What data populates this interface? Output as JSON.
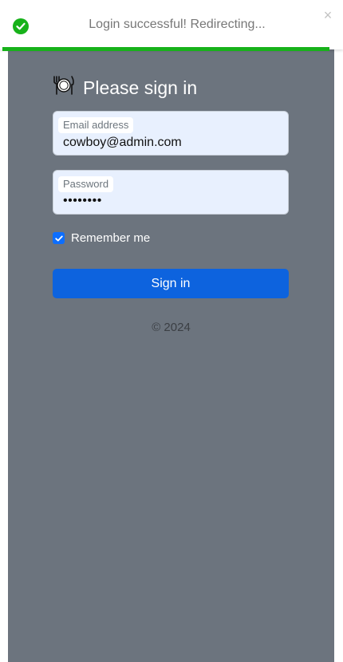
{
  "toast": {
    "message": "Login successful! Redirecting...",
    "close_symbol": "×",
    "status_icon": "check-circle-icon",
    "status_color": "#17b21a",
    "progress_fraction": 0.96
  },
  "form": {
    "title": "Please sign in",
    "logo_icon": "plate-utensils-icon",
    "email": {
      "label": "Email address",
      "value": "cowboy@admin.com"
    },
    "password": {
      "label": "Password",
      "value": "••••••••"
    },
    "remember_label": "Remember me",
    "remember_checked": true,
    "submit_label": "Sign in",
    "accent_color": "#0d63de"
  },
  "footer": {
    "copyright": "© 2024"
  },
  "theme": {
    "panel_color": "#6c747e"
  }
}
